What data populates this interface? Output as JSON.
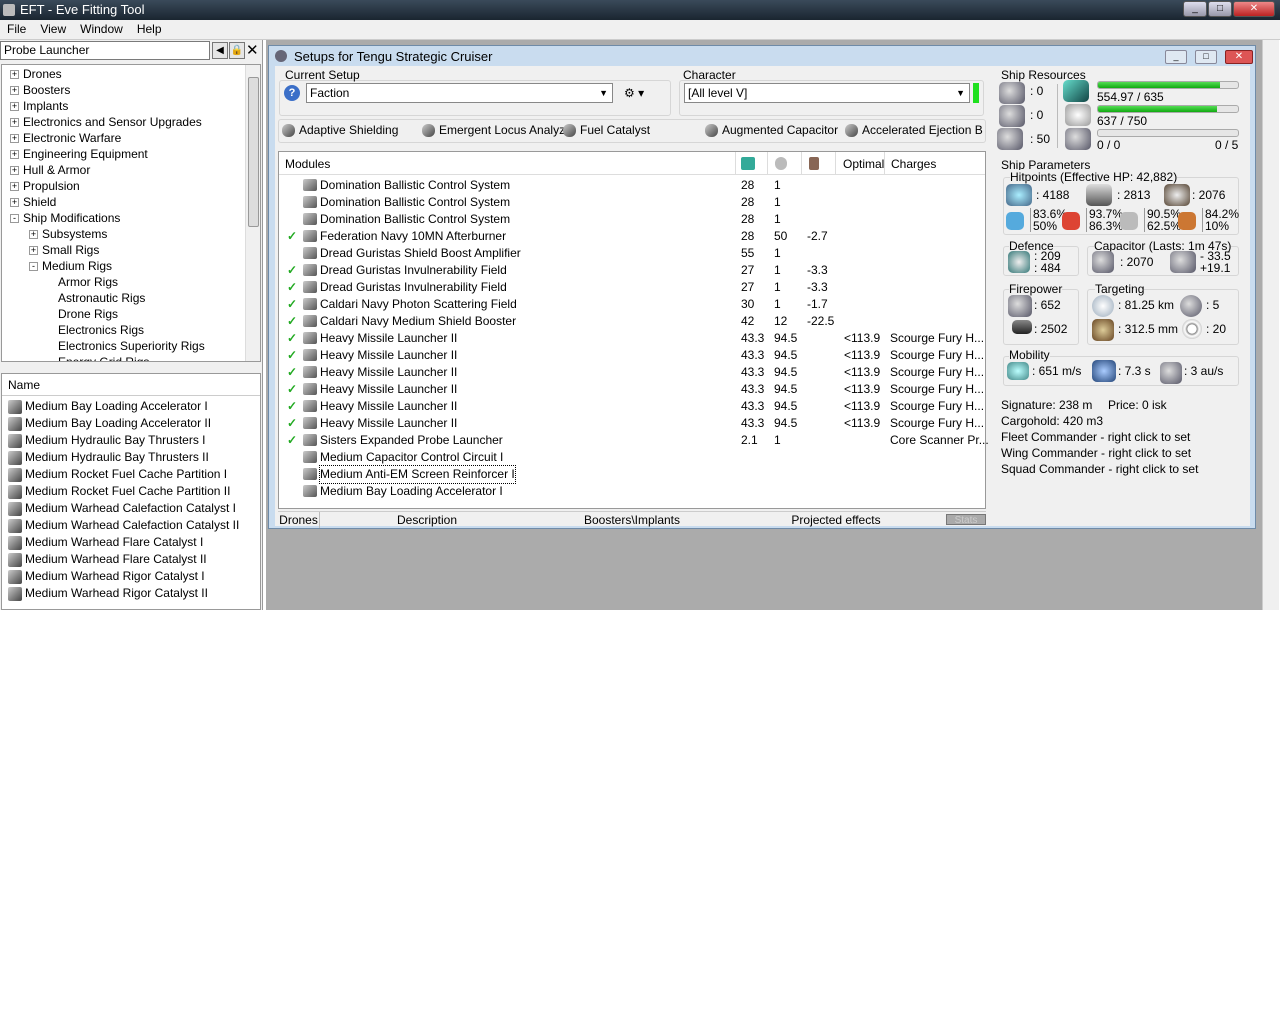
{
  "window": {
    "title": "EFT - Eve Fitting Tool",
    "controls": [
      "_",
      "□",
      "✕"
    ]
  },
  "menu": [
    "File",
    "View",
    "Window",
    "Help"
  ],
  "left": {
    "search": "Probe Launcher",
    "tree": [
      {
        "label": "Drones",
        "level": 0,
        "exp": "+"
      },
      {
        "label": "Boosters",
        "level": 0,
        "exp": "+"
      },
      {
        "label": "Implants",
        "level": 0,
        "exp": "+"
      },
      {
        "label": "Electronics and Sensor Upgrades",
        "level": 0,
        "exp": "+"
      },
      {
        "label": "Electronic Warfare",
        "level": 0,
        "exp": "+"
      },
      {
        "label": "Engineering Equipment",
        "level": 0,
        "exp": "+"
      },
      {
        "label": "Hull & Armor",
        "level": 0,
        "exp": "+"
      },
      {
        "label": "Propulsion",
        "level": 0,
        "exp": "+"
      },
      {
        "label": "Shield",
        "level": 0,
        "exp": "+"
      },
      {
        "label": "Ship Modifications",
        "level": 0,
        "exp": "-"
      },
      {
        "label": "Subsystems",
        "level": 1,
        "exp": "+"
      },
      {
        "label": "Small Rigs",
        "level": 1,
        "exp": "+"
      },
      {
        "label": "Medium Rigs",
        "level": 1,
        "exp": "-"
      },
      {
        "label": "Armor Rigs",
        "level": 2,
        "exp": ""
      },
      {
        "label": "Astronautic Rigs",
        "level": 2,
        "exp": ""
      },
      {
        "label": "Drone Rigs",
        "level": 2,
        "exp": ""
      },
      {
        "label": "Electronics Rigs",
        "level": 2,
        "exp": ""
      },
      {
        "label": "Electronics Superiority Rigs",
        "level": 2,
        "exp": ""
      },
      {
        "label": "Energy Grid Rigs",
        "level": 2,
        "exp": ""
      }
    ],
    "list_header": "Name",
    "list": [
      "Medium Bay Loading Accelerator I",
      "Medium Bay Loading Accelerator II",
      "Medium Hydraulic Bay Thrusters I",
      "Medium Hydraulic Bay Thrusters II",
      "Medium Rocket Fuel Cache Partition I",
      "Medium Rocket Fuel Cache Partition II",
      "Medium Warhead Calefaction Catalyst I",
      "Medium Warhead Calefaction Catalyst II",
      "Medium Warhead Flare Catalyst I",
      "Medium Warhead Flare Catalyst II",
      "Medium Warhead Rigor Catalyst I",
      "Medium Warhead Rigor Catalyst II"
    ]
  },
  "setup": {
    "title": "Setups for Tengu Strategic Cruiser",
    "current_setup_label": "Current Setup",
    "current_setup": "Faction",
    "character_label": "Character",
    "character": "[All level V]",
    "subsystems": [
      "Adaptive Shielding",
      "Emergent Locus Analyz",
      "Fuel Catalyst",
      "Augmented Capacitor",
      "Accelerated Ejection B"
    ],
    "columns": {
      "modules": "Modules",
      "optimal": "Optimal",
      "charges": "Charges"
    },
    "modules": [
      {
        "on": false,
        "name": "Domination Ballistic Control System",
        "cpu": "28",
        "pg": "1",
        "cap": "",
        "opt": "",
        "charge": ""
      },
      {
        "on": false,
        "name": "Domination Ballistic Control System",
        "cpu": "28",
        "pg": "1",
        "cap": "",
        "opt": "",
        "charge": ""
      },
      {
        "on": false,
        "name": "Domination Ballistic Control System",
        "cpu": "28",
        "pg": "1",
        "cap": "",
        "opt": "",
        "charge": ""
      },
      {
        "on": true,
        "name": "Federation Navy 10MN Afterburner",
        "cpu": "28",
        "pg": "50",
        "cap": "-2.7",
        "opt": "",
        "charge": ""
      },
      {
        "on": false,
        "name": "Dread Guristas Shield Boost Amplifier",
        "cpu": "55",
        "pg": "1",
        "cap": "",
        "opt": "",
        "charge": ""
      },
      {
        "on": true,
        "name": "Dread Guristas Invulnerability Field",
        "cpu": "27",
        "pg": "1",
        "cap": "-3.3",
        "opt": "",
        "charge": ""
      },
      {
        "on": true,
        "name": "Dread Guristas Invulnerability Field",
        "cpu": "27",
        "pg": "1",
        "cap": "-3.3",
        "opt": "",
        "charge": ""
      },
      {
        "on": true,
        "name": "Caldari Navy Photon Scattering Field",
        "cpu": "30",
        "pg": "1",
        "cap": "-1.7",
        "opt": "",
        "charge": ""
      },
      {
        "on": true,
        "name": "Caldari Navy Medium Shield Booster",
        "cpu": "42",
        "pg": "12",
        "cap": "-22.5",
        "opt": "",
        "charge": ""
      },
      {
        "on": true,
        "name": "Heavy Missile Launcher II",
        "cpu": "43.3",
        "pg": "94.5",
        "cap": "",
        "opt": "<113.9",
        "charge": "Scourge Fury H..."
      },
      {
        "on": true,
        "name": "Heavy Missile Launcher II",
        "cpu": "43.3",
        "pg": "94.5",
        "cap": "",
        "opt": "<113.9",
        "charge": "Scourge Fury H..."
      },
      {
        "on": true,
        "name": "Heavy Missile Launcher II",
        "cpu": "43.3",
        "pg": "94.5",
        "cap": "",
        "opt": "<113.9",
        "charge": "Scourge Fury H..."
      },
      {
        "on": true,
        "name": "Heavy Missile Launcher II",
        "cpu": "43.3",
        "pg": "94.5",
        "cap": "",
        "opt": "<113.9",
        "charge": "Scourge Fury H..."
      },
      {
        "on": true,
        "name": "Heavy Missile Launcher II",
        "cpu": "43.3",
        "pg": "94.5",
        "cap": "",
        "opt": "<113.9",
        "charge": "Scourge Fury H..."
      },
      {
        "on": true,
        "name": "Heavy Missile Launcher II",
        "cpu": "43.3",
        "pg": "94.5",
        "cap": "",
        "opt": "<113.9",
        "charge": "Scourge Fury H..."
      },
      {
        "on": true,
        "name": "Sisters Expanded Probe Launcher",
        "cpu": "2.1",
        "pg": "1",
        "cap": "",
        "opt": "",
        "charge": "Core Scanner Pr..."
      },
      {
        "on": false,
        "name": "Medium Capacitor Control Circuit I",
        "cpu": "",
        "pg": "",
        "cap": "",
        "opt": "",
        "charge": ""
      },
      {
        "on": false,
        "name": "Medium Anti-EM Screen Reinforcer I",
        "cpu": "",
        "pg": "",
        "cap": "",
        "opt": "",
        "charge": ""
      },
      {
        "on": false,
        "name": "Medium Bay Loading Accelerator I",
        "cpu": "",
        "pg": "",
        "cap": "",
        "opt": "",
        "charge": ""
      }
    ],
    "tabs": [
      "Drones",
      "Description",
      "Boosters\\Implants",
      "Projected effects",
      "Stats"
    ]
  },
  "stats": {
    "resources_label": "Ship Resources",
    "turret": ": 0",
    "launcher_hp": ": 0",
    "drone_bay": ": 50",
    "cpu": "554.97 / 635",
    "cpu_frac": 0.874,
    "pg": "637 / 750",
    "pg_frac": 0.849,
    "bw": "0 / 0",
    "calib": "0 / 5",
    "bw_frac": 0,
    "params_label": "Ship Parameters",
    "hp_label": "Hitpoints (Effective HP: 42,882)",
    "shield": ": 4188",
    "armor": ": 2813",
    "hull": ": 2076",
    "res": [
      [
        "83.6%",
        "50%"
      ],
      [
        "93.7%",
        "86.3%"
      ],
      [
        "90.5%",
        "62.5%"
      ],
      [
        "84.2%",
        "10%"
      ]
    ],
    "defence_label": "Defence",
    "def1": ": 209",
    "def2": ": 484",
    "cap_label": "Capacitor (Lasts: 1m 47s)",
    "cap": ": 2070",
    "cap_use": "- 33.5",
    "cap_regen": "+19.1",
    "fire_label": "Firepower",
    "dps": ": 652",
    "volley": ": 2502",
    "target_label": "Targeting",
    "range": ": 81.25 km",
    "targets": ": 5",
    "scanres": ": 312.5 mm",
    "sensor": ": 20",
    "mob_label": "Mobility",
    "speed": ": 651 m/s",
    "align": ": 7.3 s",
    "warp": ": 3 au/s",
    "signature": "Signature: 238 m",
    "price": "Price: 0 isk",
    "cargo": "Cargohold: 420 m3",
    "fleet": "Fleet Commander - right click to set",
    "wing": "Wing Commander - right click to set",
    "squad": "Squad Commander - right click to set"
  }
}
